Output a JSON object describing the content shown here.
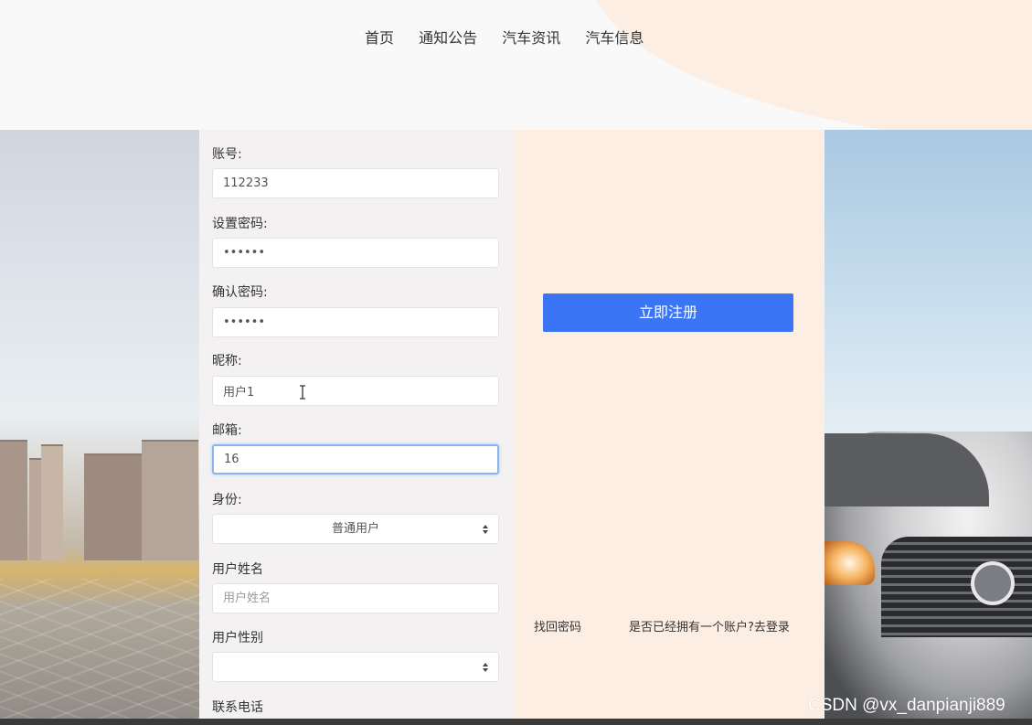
{
  "nav": {
    "items": [
      "首页",
      "通知公告",
      "汽车资讯",
      "汽车信息"
    ]
  },
  "form": {
    "account": {
      "label": "账号:",
      "value": "112233"
    },
    "password": {
      "label": "设置密码:",
      "value": "••••••"
    },
    "confirm_password": {
      "label": "确认密码:",
      "value": "••••••"
    },
    "nickname": {
      "label": "昵称:",
      "value": "用户1"
    },
    "email": {
      "label": "邮箱:",
      "value": "16"
    },
    "role": {
      "label": "身份:",
      "value": "普通用户"
    },
    "real_name": {
      "label": "用户姓名",
      "placeholder": "用户姓名"
    },
    "gender": {
      "label": "用户性别",
      "value": ""
    },
    "phone": {
      "label": "联系电话"
    }
  },
  "register_button": "立即注册",
  "links": {
    "forgot_password": "找回密码",
    "go_login": "是否已经拥有一个账户?去登录"
  },
  "watermark": "CSDN @vx_danpianji889",
  "colors": {
    "primary": "#3a75f5",
    "panel_bg": "#fdeee4",
    "form_bg": "#f3f1f1",
    "focus_border": "#8ab4f0"
  },
  "icons": {
    "select_arrows": "updown-arrow-icon",
    "text_cursor": "ibeam-cursor-icon"
  }
}
